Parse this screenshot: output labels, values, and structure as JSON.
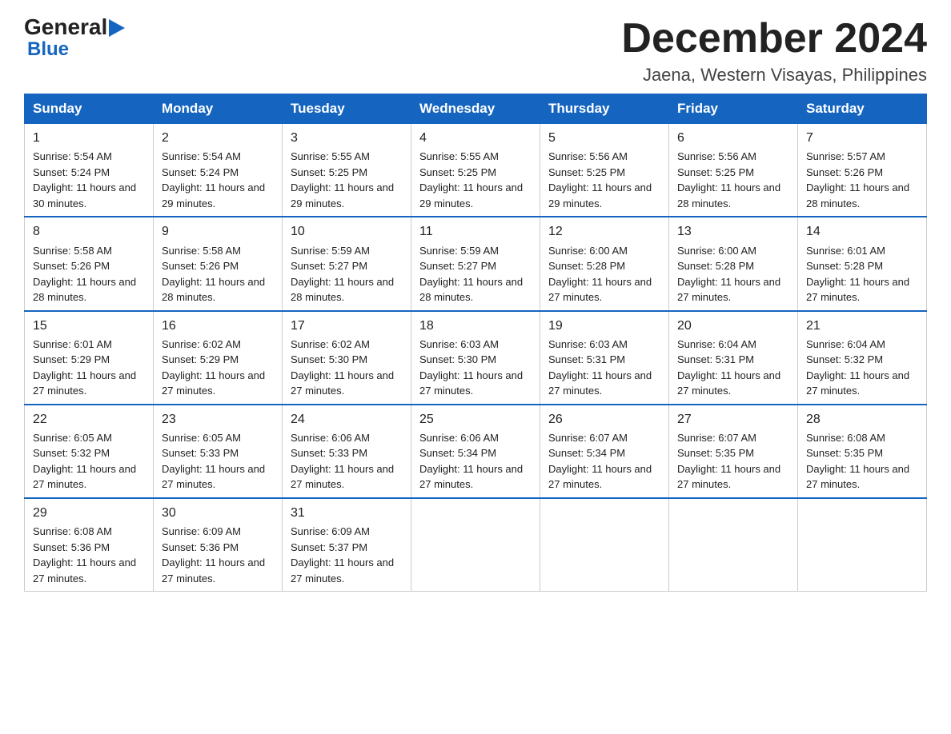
{
  "logo": {
    "general": "General",
    "blue": "Blue",
    "arrow": "▶"
  },
  "header": {
    "month": "December 2024",
    "location": "Jaena, Western Visayas, Philippines"
  },
  "weekdays": [
    "Sunday",
    "Monday",
    "Tuesday",
    "Wednesday",
    "Thursday",
    "Friday",
    "Saturday"
  ],
  "weeks": [
    [
      {
        "day": "1",
        "sunrise": "5:54 AM",
        "sunset": "5:24 PM",
        "daylight": "11 hours and 30 minutes."
      },
      {
        "day": "2",
        "sunrise": "5:54 AM",
        "sunset": "5:24 PM",
        "daylight": "11 hours and 29 minutes."
      },
      {
        "day": "3",
        "sunrise": "5:55 AM",
        "sunset": "5:25 PM",
        "daylight": "11 hours and 29 minutes."
      },
      {
        "day": "4",
        "sunrise": "5:55 AM",
        "sunset": "5:25 PM",
        "daylight": "11 hours and 29 minutes."
      },
      {
        "day": "5",
        "sunrise": "5:56 AM",
        "sunset": "5:25 PM",
        "daylight": "11 hours and 29 minutes."
      },
      {
        "day": "6",
        "sunrise": "5:56 AM",
        "sunset": "5:25 PM",
        "daylight": "11 hours and 28 minutes."
      },
      {
        "day": "7",
        "sunrise": "5:57 AM",
        "sunset": "5:26 PM",
        "daylight": "11 hours and 28 minutes."
      }
    ],
    [
      {
        "day": "8",
        "sunrise": "5:58 AM",
        "sunset": "5:26 PM",
        "daylight": "11 hours and 28 minutes."
      },
      {
        "day": "9",
        "sunrise": "5:58 AM",
        "sunset": "5:26 PM",
        "daylight": "11 hours and 28 minutes."
      },
      {
        "day": "10",
        "sunrise": "5:59 AM",
        "sunset": "5:27 PM",
        "daylight": "11 hours and 28 minutes."
      },
      {
        "day": "11",
        "sunrise": "5:59 AM",
        "sunset": "5:27 PM",
        "daylight": "11 hours and 28 minutes."
      },
      {
        "day": "12",
        "sunrise": "6:00 AM",
        "sunset": "5:28 PM",
        "daylight": "11 hours and 27 minutes."
      },
      {
        "day": "13",
        "sunrise": "6:00 AM",
        "sunset": "5:28 PM",
        "daylight": "11 hours and 27 minutes."
      },
      {
        "day": "14",
        "sunrise": "6:01 AM",
        "sunset": "5:28 PM",
        "daylight": "11 hours and 27 minutes."
      }
    ],
    [
      {
        "day": "15",
        "sunrise": "6:01 AM",
        "sunset": "5:29 PM",
        "daylight": "11 hours and 27 minutes."
      },
      {
        "day": "16",
        "sunrise": "6:02 AM",
        "sunset": "5:29 PM",
        "daylight": "11 hours and 27 minutes."
      },
      {
        "day": "17",
        "sunrise": "6:02 AM",
        "sunset": "5:30 PM",
        "daylight": "11 hours and 27 minutes."
      },
      {
        "day": "18",
        "sunrise": "6:03 AM",
        "sunset": "5:30 PM",
        "daylight": "11 hours and 27 minutes."
      },
      {
        "day": "19",
        "sunrise": "6:03 AM",
        "sunset": "5:31 PM",
        "daylight": "11 hours and 27 minutes."
      },
      {
        "day": "20",
        "sunrise": "6:04 AM",
        "sunset": "5:31 PM",
        "daylight": "11 hours and 27 minutes."
      },
      {
        "day": "21",
        "sunrise": "6:04 AM",
        "sunset": "5:32 PM",
        "daylight": "11 hours and 27 minutes."
      }
    ],
    [
      {
        "day": "22",
        "sunrise": "6:05 AM",
        "sunset": "5:32 PM",
        "daylight": "11 hours and 27 minutes."
      },
      {
        "day": "23",
        "sunrise": "6:05 AM",
        "sunset": "5:33 PM",
        "daylight": "11 hours and 27 minutes."
      },
      {
        "day": "24",
        "sunrise": "6:06 AM",
        "sunset": "5:33 PM",
        "daylight": "11 hours and 27 minutes."
      },
      {
        "day": "25",
        "sunrise": "6:06 AM",
        "sunset": "5:34 PM",
        "daylight": "11 hours and 27 minutes."
      },
      {
        "day": "26",
        "sunrise": "6:07 AM",
        "sunset": "5:34 PM",
        "daylight": "11 hours and 27 minutes."
      },
      {
        "day": "27",
        "sunrise": "6:07 AM",
        "sunset": "5:35 PM",
        "daylight": "11 hours and 27 minutes."
      },
      {
        "day": "28",
        "sunrise": "6:08 AM",
        "sunset": "5:35 PM",
        "daylight": "11 hours and 27 minutes."
      }
    ],
    [
      {
        "day": "29",
        "sunrise": "6:08 AM",
        "sunset": "5:36 PM",
        "daylight": "11 hours and 27 minutes."
      },
      {
        "day": "30",
        "sunrise": "6:09 AM",
        "sunset": "5:36 PM",
        "daylight": "11 hours and 27 minutes."
      },
      {
        "day": "31",
        "sunrise": "6:09 AM",
        "sunset": "5:37 PM",
        "daylight": "11 hours and 27 minutes."
      },
      null,
      null,
      null,
      null
    ]
  ]
}
